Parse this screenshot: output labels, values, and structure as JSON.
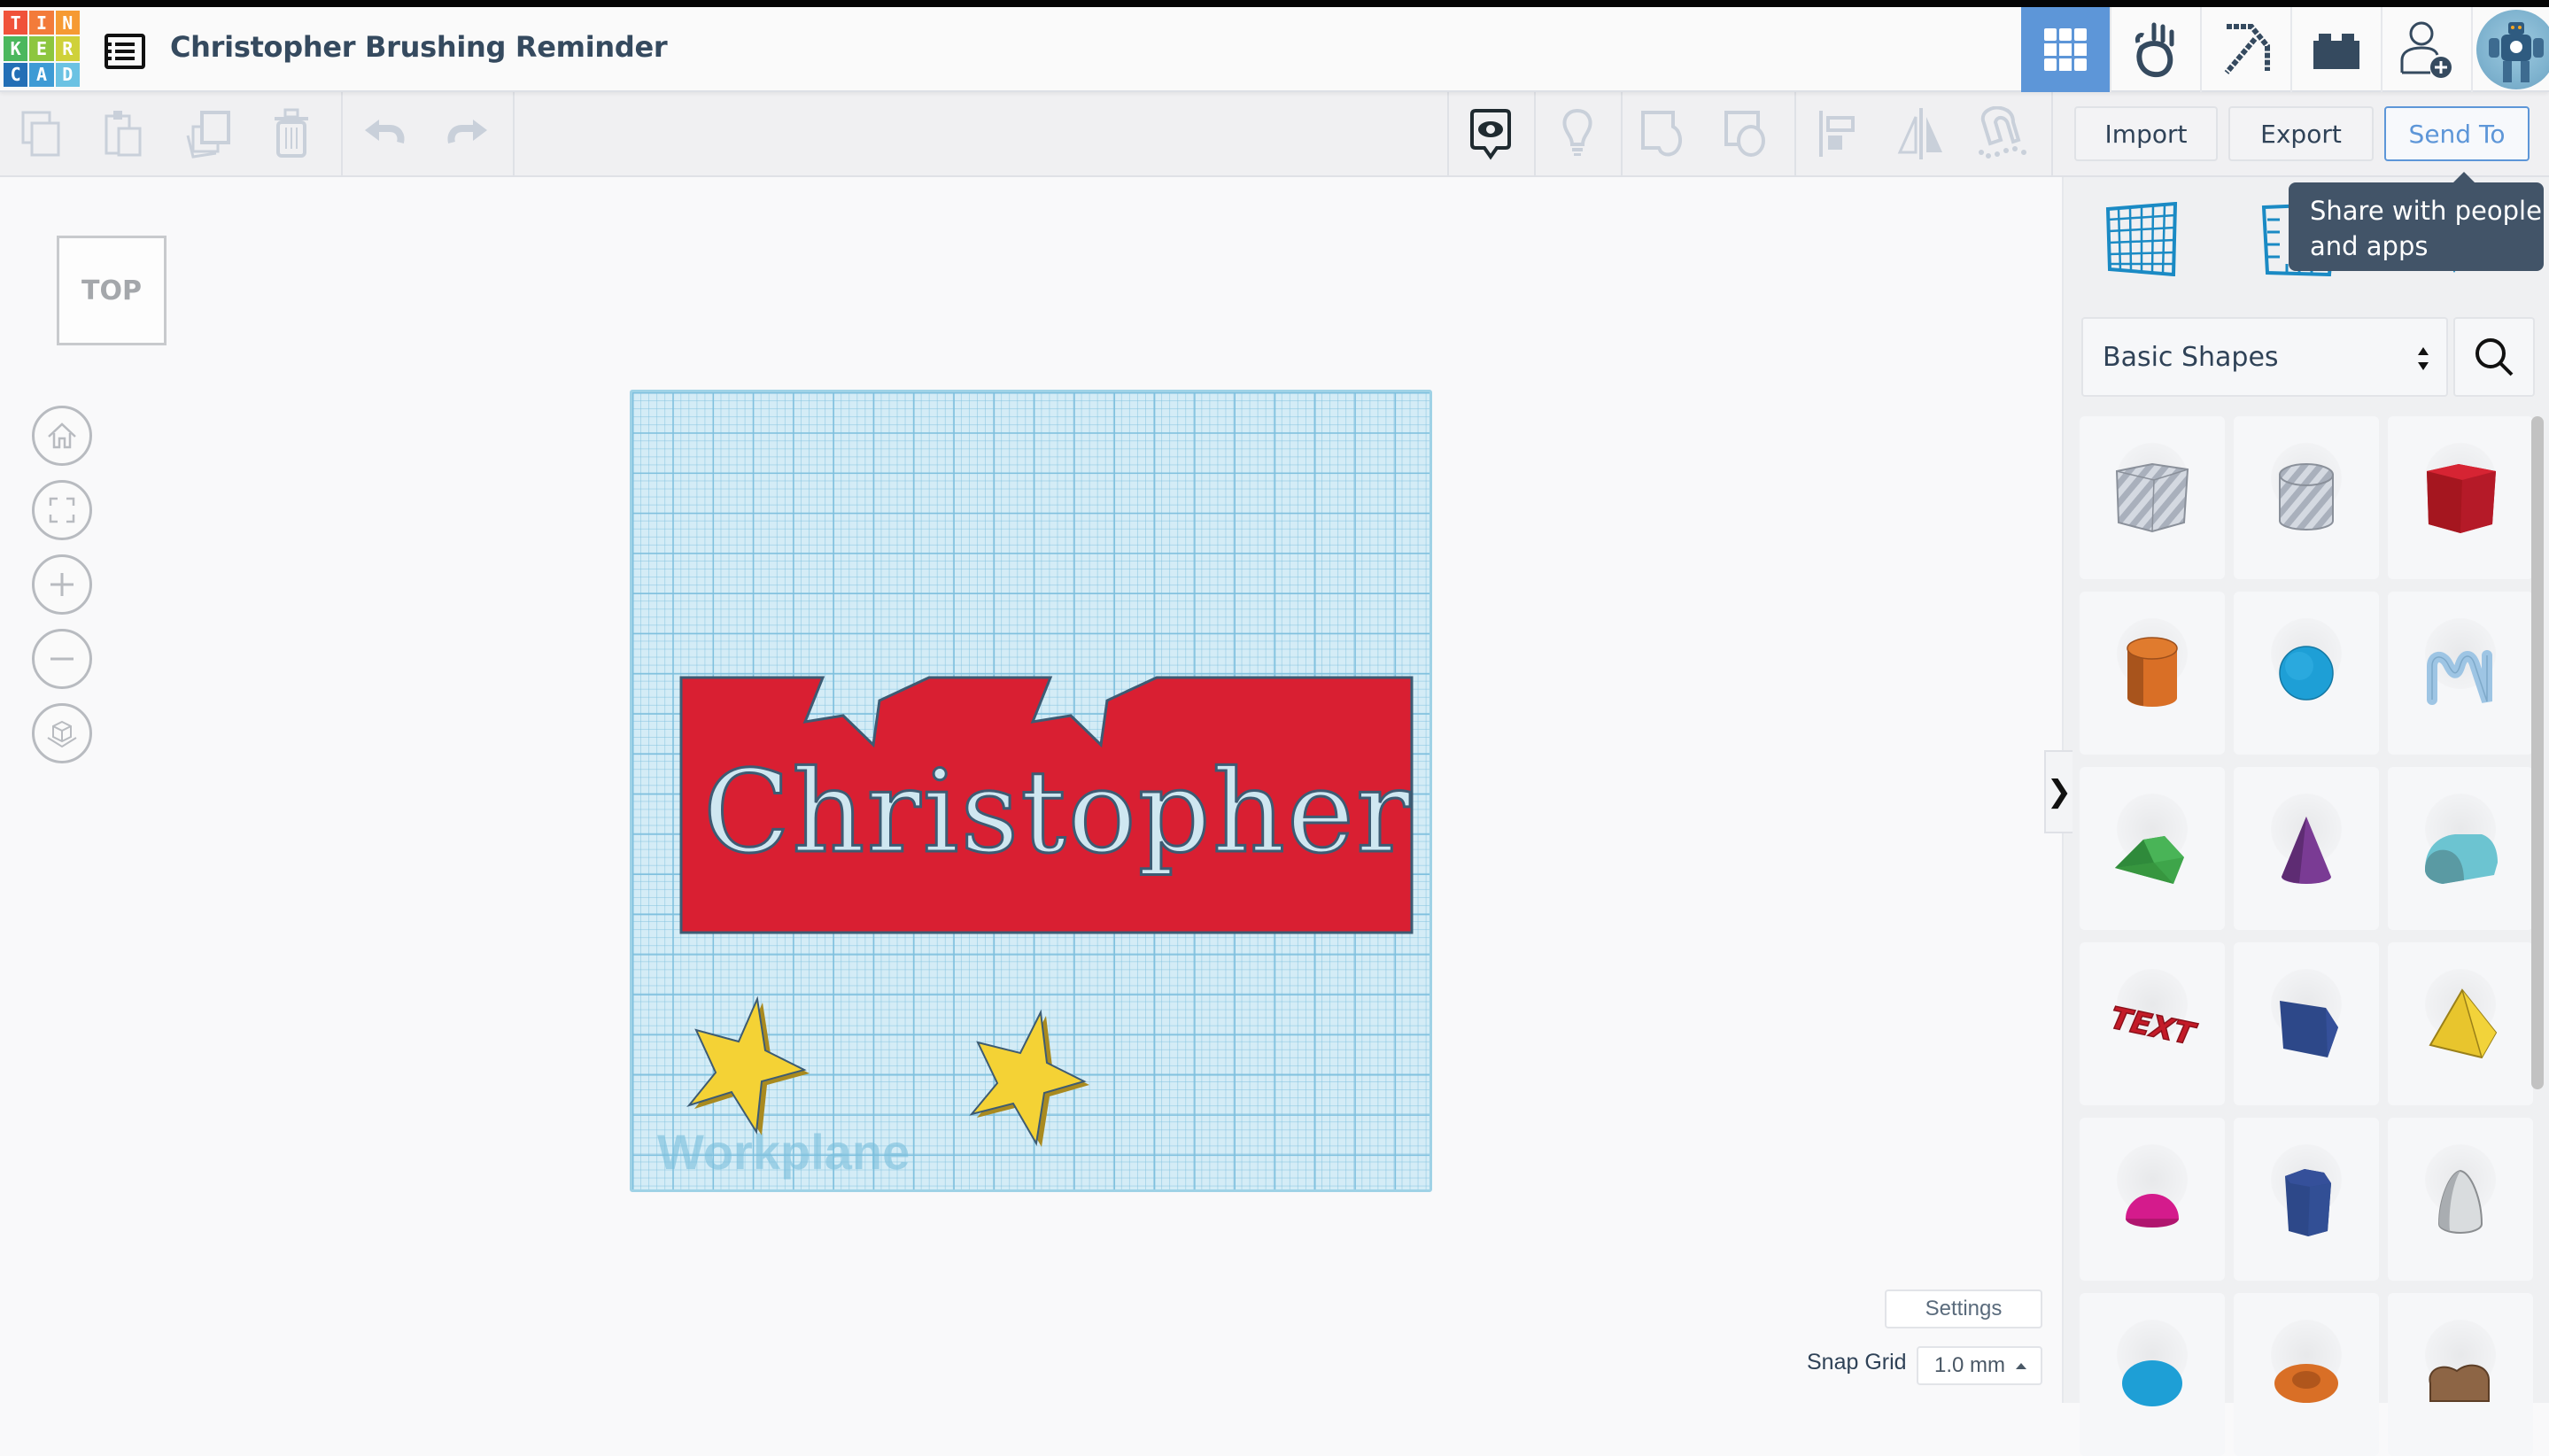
{
  "app": {
    "logo_letters": [
      "T",
      "I",
      "N",
      "K",
      "E",
      "R",
      "C",
      "A",
      "D"
    ],
    "logo_colors": [
      "#f0523a",
      "#f37b3a",
      "#f69a33",
      "#4bb75d",
      "#8dc63f",
      "#cfd13a",
      "#236fb6",
      "#3e9bd5",
      "#6bc2e3"
    ],
    "project_title": "Christopher Brushing Reminder"
  },
  "header": {
    "mode_tabs": [
      {
        "name": "3d-design",
        "icon": "grid-icon",
        "active": true
      },
      {
        "name": "codeblocks",
        "icon": "apple-hand-icon",
        "active": false
      },
      {
        "name": "minecraft",
        "icon": "pickaxe-icon",
        "active": false
      },
      {
        "name": "lego-bricks",
        "icon": "brick-icon",
        "active": false
      },
      {
        "name": "invite",
        "icon": "add-user-icon",
        "active": false
      },
      {
        "name": "profile",
        "icon": "avatar",
        "active": false
      }
    ],
    "accent": "#5d96d8"
  },
  "toolbar": {
    "edit_tools": [
      "copy",
      "paste",
      "duplicate",
      "delete"
    ],
    "history_tools": [
      "undo",
      "redo"
    ],
    "view_tools": [
      "show-notes",
      "lightbulb",
      "group",
      "ungroup",
      "align",
      "mirror",
      "cruise"
    ],
    "import_label": "Import",
    "export_label": "Export",
    "send_to_label": "Send To"
  },
  "tooltip": {
    "text_line1": "Share with people",
    "text_line2": "and apps"
  },
  "view_controls": {
    "viewcube_label": "TOP",
    "buttons": [
      "home-view",
      "fit-all",
      "zoom-in",
      "zoom-out",
      "perspective"
    ]
  },
  "workplane": {
    "label": "Workplane",
    "objects": [
      {
        "type": "plate",
        "color": "#d91f32"
      },
      {
        "type": "text",
        "value": "Christopher"
      },
      {
        "type": "star",
        "color": "#f4d235"
      },
      {
        "type": "star",
        "color": "#f4d235"
      }
    ]
  },
  "footer": {
    "settings_label": "Settings",
    "snap_grid_label": "Snap Grid",
    "snap_grid_value": "1.0 mm"
  },
  "panel": {
    "tabs": [
      "workplane",
      "ruler",
      "notes"
    ],
    "library_selected": "Basic Shapes",
    "shapes": [
      {
        "name": "Box Hole",
        "color": "#c3c9d3"
      },
      {
        "name": "Cylinder Hole",
        "color": "#c3c9d3"
      },
      {
        "name": "Box",
        "color": "#c81d2d"
      },
      {
        "name": "Cylinder",
        "color": "#d96f26"
      },
      {
        "name": "Sphere",
        "color": "#1e9fd6"
      },
      {
        "name": "Scribble",
        "color": "#9ec5e4"
      },
      {
        "name": "Roof",
        "color": "#3ea54a"
      },
      {
        "name": "Cone",
        "color": "#7a3b94"
      },
      {
        "name": "Round Roof",
        "color": "#6cc4d1"
      },
      {
        "name": "Text",
        "color": "#c41b28"
      },
      {
        "name": "Polygon",
        "color": "#2d4889"
      },
      {
        "name": "Pyramid",
        "color": "#e8c52d"
      },
      {
        "name": "Half Sphere",
        "color": "#d41b8c"
      },
      {
        "name": "Hexagonal Prism",
        "color": "#2d4889"
      },
      {
        "name": "Paraboloid",
        "color": "#d9dcde"
      },
      {
        "name": "Torus",
        "color": "#1e9fd6"
      },
      {
        "name": "Tube",
        "color": "#d96f26"
      },
      {
        "name": "Heart",
        "color": "#8d6545"
      }
    ]
  }
}
